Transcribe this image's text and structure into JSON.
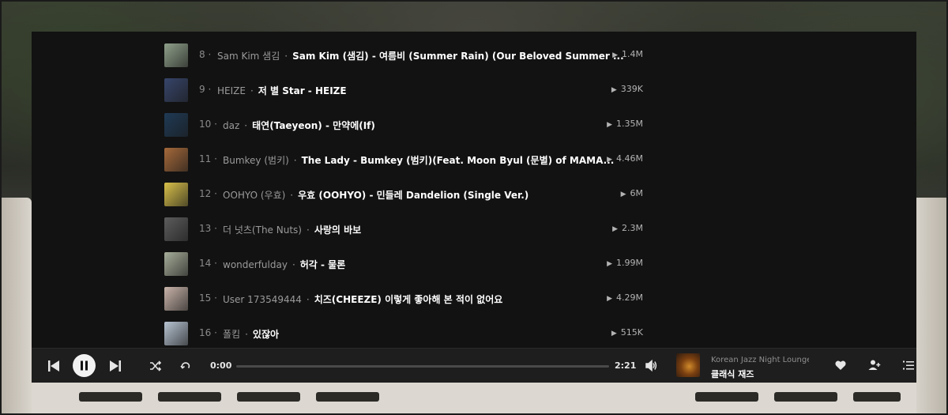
{
  "tracks": [
    {
      "num": "8 ·",
      "artist": "Sam Kim 샘김",
      "title": "Sam Kim (샘김) - 여름비 (Summer Rain) (Our Beloved Summer ...",
      "plays": "1.4M",
      "thumb": "#8fa08a"
    },
    {
      "num": "9 ·",
      "artist": "HEIZE",
      "title": "저 별 Star - HEIZE",
      "plays": "339K",
      "thumb": "#37456a"
    },
    {
      "num": "10 ·",
      "artist": "daz",
      "title": "태연(Taeyeon) - 만약에(If)",
      "plays": "1.35M",
      "thumb": "#1f3a55"
    },
    {
      "num": "11 ·",
      "artist": "Bumkey (범키)",
      "title": "The Lady - Bumkey (범키)(Feat. Moon Byul (문별) of MAMA...",
      "plays": "4.46M",
      "thumb": "#a5693a"
    },
    {
      "num": "12 ·",
      "artist": "OOHYO (우효)",
      "title": "우효 (OOHYO) - 민들레 Dandelion (Single Ver.)",
      "plays": "6M",
      "thumb": "#d9c14a"
    },
    {
      "num": "13 ·",
      "artist": "더 넛츠(The Nuts)",
      "title": "사랑의 바보",
      "plays": "2.3M",
      "thumb": "#5c5c5c"
    },
    {
      "num": "14 ·",
      "artist": "wonderfulday",
      "title": "허각 - 물론",
      "plays": "1.99M",
      "thumb": "#a7ae9a"
    },
    {
      "num": "15 ·",
      "artist": "User 173549444",
      "title": "치즈(CHEEZE) 이렇게 좋아해 본 적이 없어요",
      "plays": "4.29M",
      "thumb": "#c9b4aa"
    },
    {
      "num": "16 ·",
      "artist": "폴킴",
      "title": "있잖아",
      "plays": "515K",
      "thumb": "#b7c4d2"
    }
  ],
  "player": {
    "current_time": "0:00",
    "total_time": "2:21",
    "progress": 0,
    "now_playing_title": "Korean Jazz Night Lounge",
    "now_playing_subtitle": "클래식 재즈"
  },
  "icons": {
    "previous": "skip-previous-icon",
    "pause": "pause-icon",
    "next": "skip-next-icon",
    "shuffle": "shuffle-icon",
    "repeat": "repeat-icon",
    "volume": "volume-icon",
    "like": "heart-icon",
    "follow": "follow-user-icon",
    "queue": "queue-icon",
    "play_count": "play-triangle-icon"
  }
}
